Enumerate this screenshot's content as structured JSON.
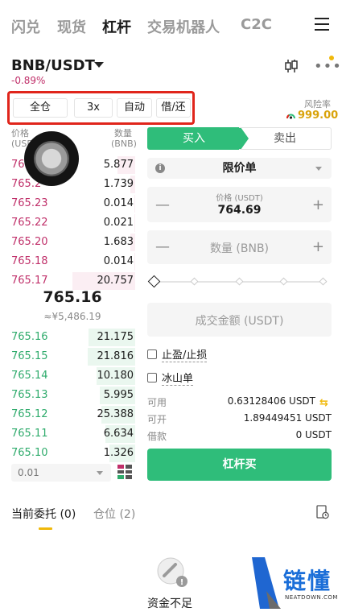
{
  "nav": {
    "tabs": [
      {
        "label": "闪兑",
        "active": false
      },
      {
        "label": "现货",
        "active": false
      },
      {
        "label": "杠杆",
        "active": true
      },
      {
        "label": "交易机器人",
        "active": false
      },
      {
        "label": "C2C",
        "active": false
      }
    ],
    "menu_icon": "hamburger-icon"
  },
  "header": {
    "pair": "BNB/USDT",
    "change": "-0.89%",
    "change_color": "#c0306a"
  },
  "margin_options": {
    "mode": "全仓",
    "leverage": "3x",
    "auto": "自动",
    "borrow_repay": "借/还"
  },
  "risk": {
    "label": "风险率",
    "value": "999.00",
    "color": "#d9a30b"
  },
  "orderbook": {
    "price_header": "价格",
    "price_unit": "(USDT)",
    "qty_header": "数量",
    "qty_unit": "(BNB)",
    "asks": [
      {
        "price": "765.",
        "qty": "5.877",
        "depth": 0.28
      },
      {
        "price": "765.2",
        "qty": "1.739",
        "depth": 0.08
      },
      {
        "price": "765.23",
        "qty": "0.014",
        "depth": 0.01
      },
      {
        "price": "765.22",
        "qty": "0.021",
        "depth": 0.01
      },
      {
        "price": "765.20",
        "qty": "1.683",
        "depth": 0.08
      },
      {
        "price": "765.18",
        "qty": "0.014",
        "depth": 0.01
      },
      {
        "price": "765.17",
        "qty": "20.757",
        "depth": 0.98
      }
    ],
    "last_price": "765.16",
    "last_price_cny": "≈¥5,486.19",
    "bids": [
      {
        "price": "765.16",
        "qty": "21.175",
        "depth": 0.72
      },
      {
        "price": "765.15",
        "qty": "21.816",
        "depth": 0.74
      },
      {
        "price": "765.14",
        "qty": "10.180",
        "depth": 0.6
      },
      {
        "price": "765.13",
        "qty": "5.995",
        "depth": 0.55
      },
      {
        "price": "765.12",
        "qty": "25.388",
        "depth": 0.52
      },
      {
        "price": "765.11",
        "qty": "6.634",
        "depth": 0.46
      },
      {
        "price": "765.10",
        "qty": "1.326",
        "depth": 0.4
      }
    ],
    "depth_step": "0.01",
    "buy_color": "#2fab6c",
    "sell_color": "#c0306a"
  },
  "order_form": {
    "buy_tab": "买入",
    "sell_tab": "卖出",
    "order_type": "限价单",
    "price_label": "价格 (USDT)",
    "price_value": "764.69",
    "qty_placeholder": "数量 (BNB)",
    "amount_placeholder": "成交金额 (USDT)",
    "tp_sl": "止盈/止损",
    "iceberg": "冰山单",
    "available_label": "可用",
    "available_value": "0.63128406 USDT",
    "can_open_label": "可开",
    "can_open_value": "1.89449451 USDT",
    "borrowed_label": "借款",
    "borrowed_value": "0 USDT",
    "submit": "杠杆买",
    "accent": "#2fbd7a"
  },
  "bottom": {
    "open_orders": "当前委托",
    "open_orders_count": "(0)",
    "positions": "仓位",
    "positions_count": "(2)",
    "empty_text": "资金不足"
  },
  "watermark": {
    "brand": "链懂",
    "sub": "NEATDOWN.COM"
  }
}
